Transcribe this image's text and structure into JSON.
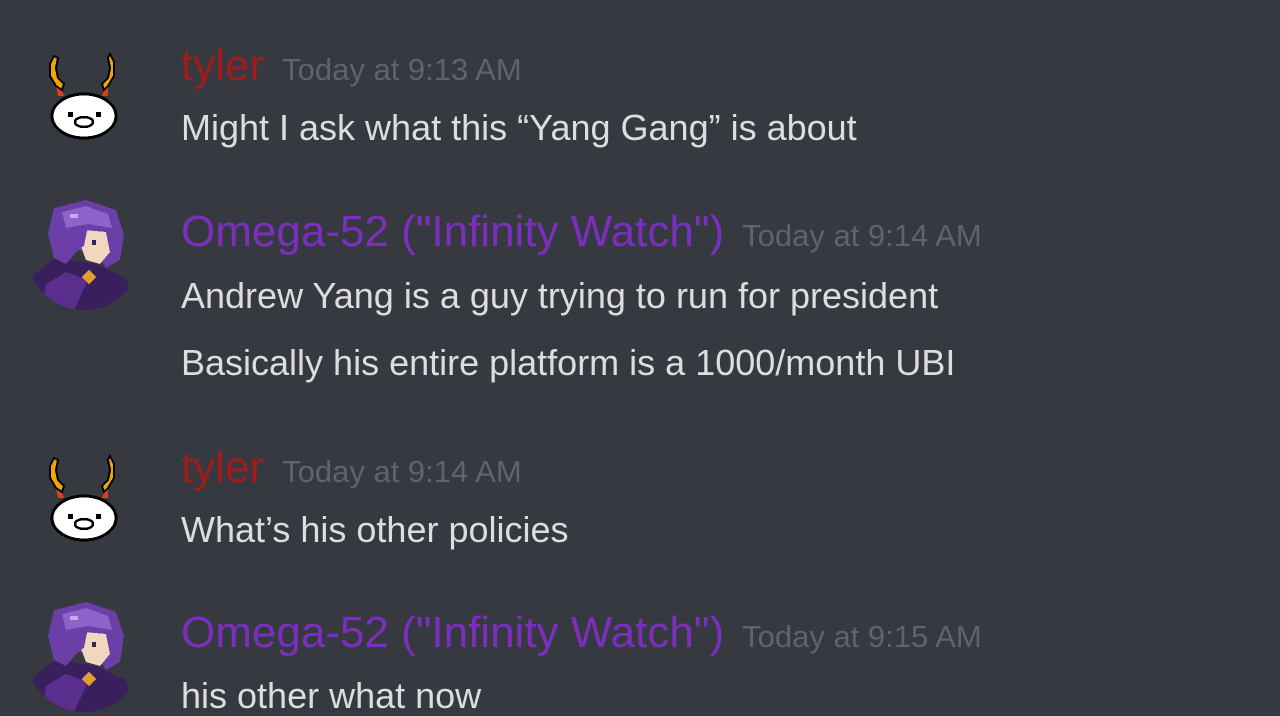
{
  "colors": {
    "background": "#36393f",
    "message_text": "#dcddde",
    "timestamp": "#5f636a",
    "tyler_name": "#a01c1c",
    "omega_name": "#7b2fbf"
  },
  "messages": [
    {
      "author": "tyler",
      "timestamp": "Today at 9:13 AM",
      "avatar_icon": "troll-horns-avatar-icon",
      "lines": [
        "Might I ask what this “Yang Gang” is about"
      ]
    },
    {
      "author": "Omega-52 (\"Infinity Watch\")",
      "timestamp": "Today at 9:14 AM",
      "avatar_icon": "purple-haired-character-avatar-icon",
      "lines": [
        "Andrew Yang is a guy trying to run for president",
        "Basically his entire platform is a 1000/month UBI"
      ]
    },
    {
      "author": "tyler",
      "timestamp": "Today at 9:14 AM",
      "avatar_icon": "troll-horns-avatar-icon",
      "lines": [
        "What’s his other policies"
      ]
    },
    {
      "author": "Omega-52 (\"Infinity Watch\")",
      "timestamp": "Today at 9:15 AM",
      "avatar_icon": "purple-haired-character-avatar-icon",
      "lines": [
        "his other what now"
      ]
    }
  ]
}
